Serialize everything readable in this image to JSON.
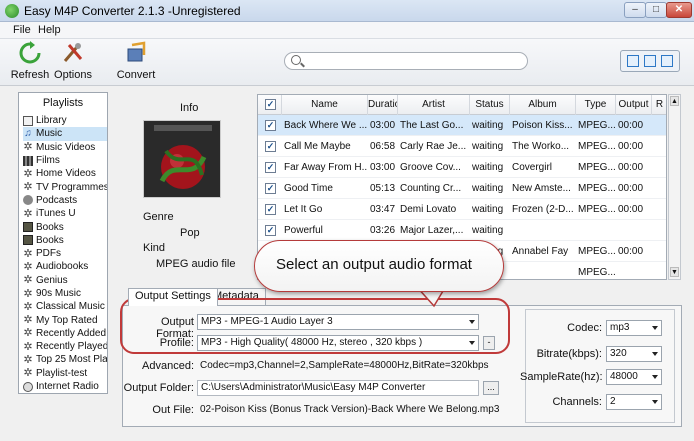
{
  "window": {
    "title": "Easy M4P Converter 2.1.3 -Unregistered"
  },
  "menu": [
    "File",
    "Help"
  ],
  "toolbar": {
    "refresh": "Refresh",
    "options": "Options",
    "convert": "Convert"
  },
  "search": {
    "placeholder": ""
  },
  "sidebar": {
    "header": "Playlists",
    "items": [
      {
        "label": "Library",
        "icon": "library-icon"
      },
      {
        "label": "Music",
        "icon": "music-note-icon"
      },
      {
        "label": "Music Videos",
        "icon": "gear-icon"
      },
      {
        "label": "Films",
        "icon": "film-icon"
      },
      {
        "label": "Home Videos",
        "icon": "gear-icon"
      },
      {
        "label": "TV Programmes",
        "icon": "gear-icon"
      },
      {
        "label": "Podcasts",
        "icon": "podcast-icon"
      },
      {
        "label": "iTunes U",
        "icon": "gear-icon"
      },
      {
        "label": "Books",
        "icon": "book-icon"
      },
      {
        "label": "Books",
        "icon": "book-icon"
      },
      {
        "label": "PDFs",
        "icon": "gear-icon"
      },
      {
        "label": "Audiobooks",
        "icon": "gear-icon"
      },
      {
        "label": "Genius",
        "icon": "gear-icon"
      },
      {
        "label": "90s Music",
        "icon": "gear-icon"
      },
      {
        "label": "Classical Music",
        "icon": "gear-icon"
      },
      {
        "label": "My Top Rated",
        "icon": "gear-icon"
      },
      {
        "label": "Recently Added",
        "icon": "gear-icon"
      },
      {
        "label": "Recently Played",
        "icon": "gear-icon"
      },
      {
        "label": "Top 25 Most Pla",
        "icon": "gear-icon"
      },
      {
        "label": "Playlist-test",
        "icon": "gear-icon"
      },
      {
        "label": "Internet Radio",
        "icon": "radio-icon"
      }
    ]
  },
  "info": {
    "title": "Info",
    "genre_label": "Genre",
    "genre_value": "Pop",
    "kind_label": "Kind",
    "kind_value": "MPEG audio file"
  },
  "table": {
    "columns": [
      "Name",
      "Duration",
      "Artist",
      "Status",
      "Album",
      "Type",
      "Output",
      "R"
    ],
    "rows": [
      [
        "Back Where We ...",
        "03:00",
        "The Last Go...",
        "waiting",
        "Poison Kiss...",
        "MPEG...",
        "00:00"
      ],
      [
        "Call Me Maybe",
        "06:58",
        "Carly Rae Je...",
        "waiting",
        "The Worko...",
        "MPEG...",
        "00:00"
      ],
      [
        "Far Away From H...",
        "03:00",
        "Groove Cov...",
        "waiting",
        "Covergirl",
        "MPEG...",
        "00:00"
      ],
      [
        "Good Time",
        "05:13",
        "Counting Cr...",
        "waiting",
        "New Amste...",
        "MPEG...",
        "00:00"
      ],
      [
        "Let It Go",
        "03:47",
        "Demi Lovato",
        "waiting",
        "Frozen (2-D...",
        "MPEG...",
        "00:00"
      ],
      [
        "Powerful",
        "03:26",
        "Major Lazer,...",
        "waiting",
        "",
        "",
        ""
      ],
      [
        "",
        "",
        "",
        "waiting",
        "Annabel Fay",
        "MPEG...",
        "00:00"
      ],
      [
        "",
        "",
        "",
        "",
        "",
        "MPEG...",
        ""
      ]
    ]
  },
  "callout": {
    "text": "Select an output audio format"
  },
  "tabs": {
    "output": "Output Settings",
    "metadata": "Metadata"
  },
  "settings": {
    "output_format_label": "Output Format:",
    "output_format_value": "MP3 - MPEG-1 Audio Layer 3",
    "profile_label": "Profile:",
    "profile_value": "MP3 - High Quality( 48000 Hz, stereo , 320 kbps  )",
    "advanced_label": "Advanced:",
    "advanced_value": "Codec=mp3,Channel=2,SampleRate=48000Hz,BitRate=320kbps",
    "output_folder_label": "Output Folder:",
    "output_folder_value": "C:\\Users\\Administrator\\Music\\Easy M4P Converter",
    "out_file_label": "Out File:",
    "out_file_value": "02-Poison Kiss (Bonus Track Version)-Back Where We Belong.mp3",
    "browse": "...",
    "profile_btn": "-",
    "codec_label": "Codec:",
    "codec_value": "mp3",
    "bitrate_label": "Bitrate(kbps):",
    "bitrate_value": "320",
    "samplerate_label": "SampleRate(hz):",
    "samplerate_value": "48000",
    "channels_label": "Channels:",
    "channels_value": "2"
  },
  "colors": {
    "accent": "#2d78c6",
    "callout_border": "#b43a3a",
    "selected_row": "#d5e8fa"
  }
}
